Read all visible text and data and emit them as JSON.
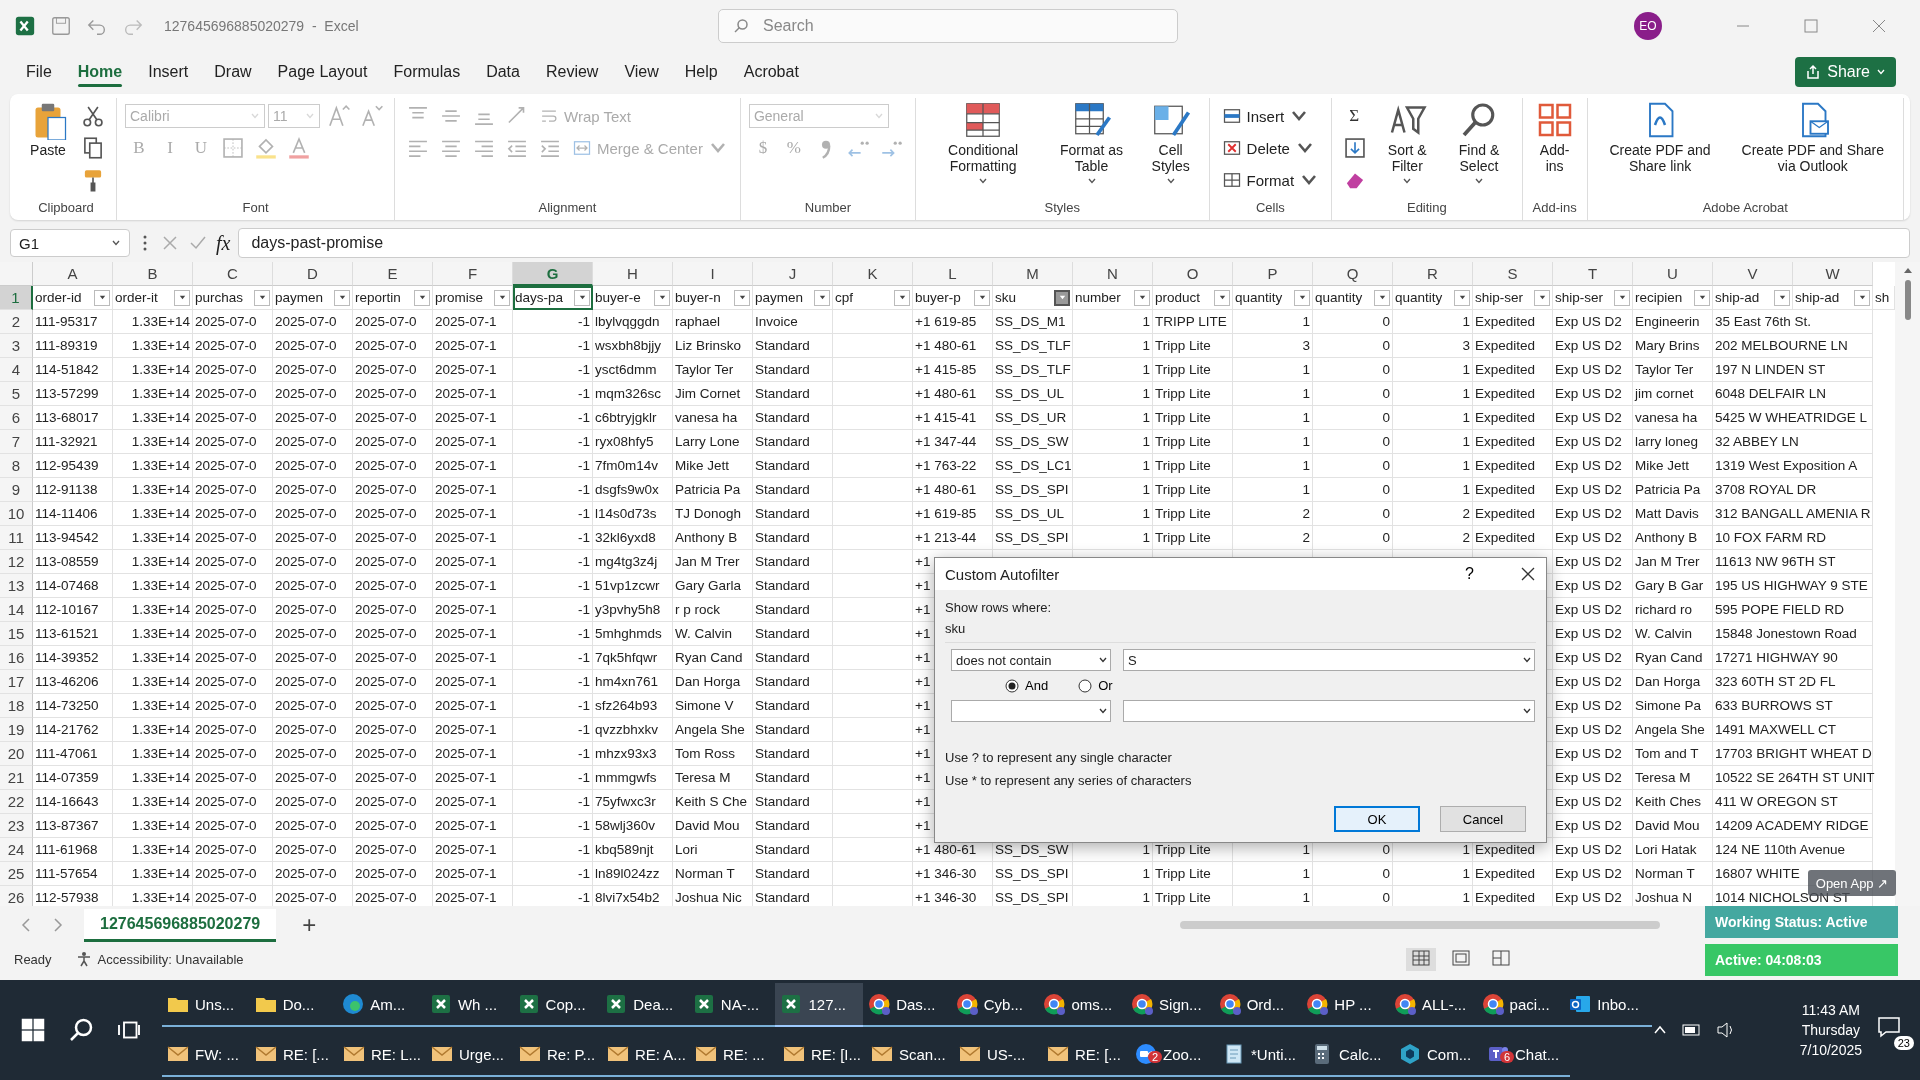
{
  "title_bar": {
    "title": "127645696885020279  -  Excel",
    "search": {
      "placeholder": "Search"
    },
    "avatar": "EO"
  },
  "ribbon_tabs": [
    {
      "label": "File",
      "selected": false
    },
    {
      "label": "Home",
      "selected": true
    },
    {
      "label": "Insert",
      "selected": false
    },
    {
      "label": "Draw",
      "selected": false
    },
    {
      "label": "Page Layout",
      "selected": false
    },
    {
      "label": "Formulas",
      "selected": false
    },
    {
      "label": "Data",
      "selected": false
    },
    {
      "label": "Review",
      "selected": false
    },
    {
      "label": "View",
      "selected": false
    },
    {
      "label": "Help",
      "selected": false
    },
    {
      "label": "Acrobat",
      "selected": false
    }
  ],
  "share_button": "Share",
  "ribbon": [
    {
      "label": "Clipboard",
      "disabled": false,
      "items": [
        {
          "kind": "big",
          "label": "Paste",
          "dropdown": false
        },
        {
          "kind": "stack",
          "rows": [
            [
              {
                "kind": "icon"
              }
            ],
            [
              {
                "kind": "icon"
              }
            ],
            [
              {
                "kind": "icon"
              }
            ]
          ]
        }
      ]
    },
    {
      "label": "Font",
      "disabled": true,
      "items": [
        {
          "kind": "stack",
          "rows": [
            [
              {
                "kind": "combo",
                "value": "Calibri"
              },
              {
                "kind": "combo",
                "value": "11"
              },
              {
                "kind": "icon"
              },
              {
                "kind": "icon"
              }
            ],
            [
              {
                "kind": "glyph",
                "label": "B"
              },
              {
                "kind": "glyph",
                "label": "I"
              },
              {
                "kind": "glyph",
                "label": "U"
              },
              {
                "kind": "icon"
              },
              {
                "kind": "icon"
              },
              {
                "kind": "icon"
              }
            ]
          ]
        }
      ]
    },
    {
      "label": "Alignment",
      "disabled": true,
      "items": [
        {
          "kind": "stack",
          "rows": [
            [
              {
                "kind": "icon"
              },
              {
                "kind": "icon"
              },
              {
                "kind": "icon"
              },
              {
                "kind": "icon"
              },
              {
                "kind": "small",
                "label": "Wrap Text",
                "dropdown": false
              }
            ],
            [
              {
                "kind": "icon"
              },
              {
                "kind": "icon"
              },
              {
                "kind": "icon"
              },
              {
                "kind": "icon"
              },
              {
                "kind": "icon"
              },
              {
                "kind": "small",
                "label": "Merge & Center",
                "dropdown": true
              }
            ]
          ]
        }
      ]
    },
    {
      "label": "Number",
      "disabled": true,
      "items": [
        {
          "kind": "stack",
          "rows": [
            [
              {
                "kind": "combo",
                "value": "General"
              }
            ],
            [
              {
                "kind": "glyph",
                "label": "$"
              },
              {
                "kind": "glyph",
                "label": "%"
              },
              {
                "kind": "icon"
              },
              {
                "kind": "icon"
              },
              {
                "kind": "icon"
              }
            ]
          ]
        }
      ]
    },
    {
      "label": "Styles",
      "disabled": false,
      "items": [
        {
          "kind": "big",
          "label": "Conditional Formatting",
          "dropdown": true
        },
        {
          "kind": "big",
          "label": "Format as Table",
          "dropdown": true
        },
        {
          "kind": "big",
          "label": "Cell Styles",
          "dropdown": true
        }
      ]
    },
    {
      "label": "Cells",
      "disabled": false,
      "items": [
        {
          "kind": "stack",
          "rows": [
            [
              {
                "kind": "small",
                "label": "Insert",
                "dropdown": true
              }
            ],
            [
              {
                "kind": "small",
                "label": "Delete",
                "dropdown": true
              }
            ],
            [
              {
                "kind": "small",
                "label": "Format",
                "dropdown": true
              }
            ]
          ]
        }
      ]
    },
    {
      "label": "Editing",
      "disabled": false,
      "items": [
        {
          "kind": "stack",
          "rows": [
            [
              {
                "kind": "glyph",
                "label": "Σ"
              }
            ],
            [
              {
                "kind": "icon"
              }
            ],
            [
              {
                "kind": "icon"
              }
            ]
          ]
        },
        {
          "kind": "big",
          "label": "Sort & Filter",
          "dropdown": true
        },
        {
          "kind": "big",
          "label": "Find & Select",
          "dropdown": true
        }
      ]
    },
    {
      "label": "Add-ins",
      "disabled": false,
      "items": [
        {
          "kind": "big",
          "label": "Add-ins",
          "dropdown": false
        }
      ]
    },
    {
      "label": "Adobe Acrobat",
      "disabled": false,
      "items": [
        {
          "kind": "big",
          "label": "Create PDF and Share link",
          "dropdown": false
        },
        {
          "kind": "big",
          "label": "Create PDF and Share via Outlook",
          "dropdown": false
        }
      ]
    }
  ],
  "formula_bar": {
    "name_box": "G1",
    "fx": "fx",
    "formula": "days-past-promise"
  },
  "grid": {
    "columns": [
      {
        "letter": "A",
        "selected": false
      },
      {
        "letter": "B",
        "selected": false
      },
      {
        "letter": "C",
        "selected": false
      },
      {
        "letter": "D",
        "selected": false
      },
      {
        "letter": "E",
        "selected": false
      },
      {
        "letter": "F",
        "selected": false
      },
      {
        "letter": "G",
        "selected": true
      },
      {
        "letter": "H",
        "selected": false
      },
      {
        "letter": "I",
        "selected": false
      },
      {
        "letter": "J",
        "selected": false
      },
      {
        "letter": "K",
        "selected": false
      },
      {
        "letter": "L",
        "selected": false
      },
      {
        "letter": "M",
        "selected": false
      },
      {
        "letter": "N",
        "selected": false
      },
      {
        "letter": "O",
        "selected": false
      },
      {
        "letter": "P",
        "selected": false
      },
      {
        "letter": "Q",
        "selected": false
      },
      {
        "letter": "R",
        "selected": false
      },
      {
        "letter": "S",
        "selected": false
      },
      {
        "letter": "T",
        "selected": false
      },
      {
        "letter": "U",
        "selected": false
      },
      {
        "letter": "V",
        "selected": false
      },
      {
        "letter": "W",
        "selected": false
      }
    ],
    "header_row": {
      "number": "1",
      "selected": true,
      "cells": [
        {
          "label": "order-id",
          "selected": false,
          "filter_open": false
        },
        {
          "label": "order-it",
          "selected": false,
          "filter_open": false
        },
        {
          "label": "purchas",
          "selected": false,
          "filter_open": false
        },
        {
          "label": "paymen",
          "selected": false,
          "filter_open": false
        },
        {
          "label": "reportin",
          "selected": false,
          "filter_open": false
        },
        {
          "label": "promise",
          "selected": false,
          "filter_open": false
        },
        {
          "label": "days-pa",
          "selected": true,
          "filter_open": false
        },
        {
          "label": "buyer-e",
          "selected": false,
          "filter_open": false
        },
        {
          "label": "buyer-n",
          "selected": false,
          "filter_open": false
        },
        {
          "label": "paymen",
          "selected": false,
          "filter_open": false
        },
        {
          "label": "cpf",
          "selected": false,
          "filter_open": false
        },
        {
          "label": "buyer-p",
          "selected": false,
          "filter_open": false
        },
        {
          "label": "sku",
          "selected": false,
          "filter_open": true
        },
        {
          "label": "number",
          "selected": false,
          "filter_open": false
        },
        {
          "label": "product",
          "selected": false,
          "filter_open": false
        },
        {
          "label": "quantity",
          "selected": false,
          "filter_open": false
        },
        {
          "label": "quantity",
          "selected": false,
          "filter_open": false
        },
        {
          "label": "quantity",
          "selected": false,
          "filter_open": false
        },
        {
          "label": "ship-ser",
          "selected": false,
          "filter_open": false
        },
        {
          "label": "ship-ser",
          "selected": false,
          "filter_open": false
        },
        {
          "label": "recipien",
          "selected": false,
          "filter_open": false
        },
        {
          "label": "ship-ad",
          "selected": false,
          "filter_open": false
        },
        {
          "label": "ship-ad",
          "selected": false,
          "filter_open": false
        },
        {
          "label": "sh",
          "selected": false
        }
      ]
    },
    "rows": [
      {
        "number": "2",
        "cells": [
          "111-95317",
          "1.33E+14",
          "2025-07-0",
          "2025-07-0",
          "2025-07-0",
          "2025-07-1",
          "-1",
          "lbylvqggdn",
          "raphael",
          "Invoice",
          null,
          "+1 619-85",
          "SS_DS_M1",
          "1",
          "TRIPP LITE",
          "1",
          "0",
          "1",
          "Expedited",
          "Exp US D2",
          "Engineerin",
          "35 East 76th St.",
          null
        ]
      },
      {
        "number": "3",
        "cells": [
          "111-89319",
          "1.33E+14",
          "2025-07-0",
          "2025-07-0",
          "2025-07-0",
          "2025-07-1",
          "-1",
          "wsxbh8bjjy",
          "Liz Brinsko",
          "Standard",
          null,
          "+1 480-61",
          "SS_DS_TLF",
          "1",
          "Tripp Lite",
          "3",
          "0",
          "3",
          "Expedited",
          "Exp US D2",
          "Mary Brins",
          "202 MELBOURNE LN",
          null
        ]
      },
      {
        "number": "4",
        "cells": [
          "114-51842",
          "1.33E+14",
          "2025-07-0",
          "2025-07-0",
          "2025-07-0",
          "2025-07-1",
          "-1",
          "ysct6dmm",
          "Taylor Ter",
          "Standard",
          null,
          "+1 415-85",
          "SS_DS_TLF",
          "1",
          "Tripp Lite",
          "1",
          "0",
          "1",
          "Expedited",
          "Exp US D2",
          "Taylor Ter",
          "197 N LINDEN ST",
          null
        ]
      },
      {
        "number": "5",
        "cells": [
          "113-57299",
          "1.33E+14",
          "2025-07-0",
          "2025-07-0",
          "2025-07-0",
          "2025-07-1",
          "-1",
          "mqm326sc",
          "Jim Cornet",
          "Standard",
          null,
          "+1 480-61",
          "SS_DS_UL",
          "1",
          "Tripp Lite",
          "1",
          "0",
          "1",
          "Expedited",
          "Exp US D2",
          "jim cornet",
          "6048 DELFAIR LN",
          null
        ]
      },
      {
        "number": "6",
        "cells": [
          "113-68017",
          "1.33E+14",
          "2025-07-0",
          "2025-07-0",
          "2025-07-0",
          "2025-07-1",
          "-1",
          "c6btryjgklr",
          "vanesa ha",
          "Standard",
          null,
          "+1 415-41",
          "SS_DS_UR",
          "1",
          "Tripp Lite",
          "1",
          "0",
          "1",
          "Expedited",
          "Exp US D2",
          "vanesa ha",
          "5425 W WHEATRIDGE L",
          null
        ]
      },
      {
        "number": "7",
        "cells": [
          "111-32921",
          "1.33E+14",
          "2025-07-0",
          "2025-07-0",
          "2025-07-0",
          "2025-07-1",
          "-1",
          "ryx08hfy5",
          "Larry Lone",
          "Standard",
          null,
          "+1 347-44",
          "SS_DS_SW",
          "1",
          "Tripp Lite",
          "1",
          "0",
          "1",
          "Expedited",
          "Exp US D2",
          "larry loneg",
          "32 ABBEY LN",
          null
        ]
      },
      {
        "number": "8",
        "cells": [
          "112-95439",
          "1.33E+14",
          "2025-07-0",
          "2025-07-0",
          "2025-07-0",
          "2025-07-1",
          "-1",
          "7fm0m14v",
          "Mike Jett",
          "Standard",
          null,
          "+1 763-22",
          "SS_DS_LC1",
          "1",
          "Tripp Lite",
          "1",
          "0",
          "1",
          "Expedited",
          "Exp US D2",
          "Mike Jett",
          "1319 West Exposition A",
          null
        ]
      },
      {
        "number": "9",
        "cells": [
          "112-91138",
          "1.33E+14",
          "2025-07-0",
          "2025-07-0",
          "2025-07-0",
          "2025-07-1",
          "-1",
          "dsgfs9w0x",
          "Patricia Pa",
          "Standard",
          null,
          "+1 480-61",
          "SS_DS_SPI",
          "1",
          "Tripp Lite",
          "1",
          "0",
          "1",
          "Expedited",
          "Exp US D2",
          "Patricia Pa",
          "3708 ROYAL DR",
          null
        ]
      },
      {
        "number": "10",
        "cells": [
          "114-11406",
          "1.33E+14",
          "2025-07-0",
          "2025-07-0",
          "2025-07-0",
          "2025-07-1",
          "-1",
          "l14s0d73s",
          "TJ Donogh",
          "Standard",
          null,
          "+1 619-85",
          "SS_DS_UL",
          "1",
          "Tripp Lite",
          "2",
          "0",
          "2",
          "Expedited",
          "Exp US D2",
          "Matt Davis",
          "312 BANGALL AMENIA R",
          null
        ]
      },
      {
        "number": "11",
        "cells": [
          "113-94542",
          "1.33E+14",
          "2025-07-0",
          "2025-07-0",
          "2025-07-0",
          "2025-07-1",
          "-1",
          "32kl6yxd8",
          "Anthony B",
          "Standard",
          null,
          "+1 213-44",
          "SS_DS_SPI",
          "1",
          "Tripp Lite",
          "2",
          "0",
          "2",
          "Expedited",
          "Exp US D2",
          "Anthony B",
          "10 FOX FARM RD",
          null
        ]
      },
      {
        "number": "12",
        "cells": [
          "113-08559",
          "1.33E+14",
          "2025-07-0",
          "2025-07-0",
          "2025-07-0",
          "2025-07-1",
          "-1",
          "mg4tg3z4j",
          "Jan M Trer",
          "Standard",
          null,
          "+1",
          null,
          null,
          null,
          null,
          null,
          null,
          null,
          "Exp US D2",
          "Jan M Trer",
          "11613 NW 96TH ST",
          null
        ]
      },
      {
        "number": "13",
        "cells": [
          "114-07468",
          "1.33E+14",
          "2025-07-0",
          "2025-07-0",
          "2025-07-0",
          "2025-07-1",
          "-1",
          "51vp1zcwr",
          "Gary Garla",
          "Standard",
          null,
          "+1",
          null,
          null,
          null,
          null,
          null,
          null,
          null,
          "Exp US D2",
          "Gary B Gar",
          "195 US HIGHWAY 9 STE",
          null
        ]
      },
      {
        "number": "14",
        "cells": [
          "112-10167",
          "1.33E+14",
          "2025-07-0",
          "2025-07-0",
          "2025-07-0",
          "2025-07-1",
          "-1",
          "y3pvhy5h8",
          "r p rock",
          "Standard",
          null,
          "+1",
          null,
          null,
          null,
          null,
          null,
          null,
          null,
          "Exp US D2",
          "richard  ro",
          "595 POPE FIELD RD",
          null
        ]
      },
      {
        "number": "15",
        "cells": [
          "113-61521",
          "1.33E+14",
          "2025-07-0",
          "2025-07-0",
          "2025-07-0",
          "2025-07-1",
          "-1",
          "5mhghmds",
          "W. Calvin",
          "Standard",
          null,
          "+1",
          null,
          null,
          null,
          null,
          null,
          null,
          null,
          "Exp US D2",
          "W. Calvin",
          "15848 Jonestown Road",
          null
        ]
      },
      {
        "number": "16",
        "cells": [
          "114-39352",
          "1.33E+14",
          "2025-07-0",
          "2025-07-0",
          "2025-07-0",
          "2025-07-1",
          "-1",
          "7qk5hfqwr",
          "Ryan Cand",
          "Standard",
          null,
          "+1",
          null,
          null,
          null,
          null,
          null,
          null,
          null,
          "Exp US D2",
          "Ryan Cand",
          "17271 HIGHWAY 90",
          null
        ]
      },
      {
        "number": "17",
        "cells": [
          "113-46206",
          "1.33E+14",
          "2025-07-0",
          "2025-07-0",
          "2025-07-0",
          "2025-07-1",
          "-1",
          "hm4xn761",
          "Dan Horga",
          "Standard",
          null,
          "+1",
          null,
          null,
          null,
          null,
          null,
          null,
          null,
          "Exp US D2",
          "Dan Horga",
          "323 60TH ST 2D FL",
          null
        ]
      },
      {
        "number": "18",
        "cells": [
          "114-73250",
          "1.33E+14",
          "2025-07-0",
          "2025-07-0",
          "2025-07-0",
          "2025-07-1",
          "-1",
          "sfz264b93",
          "Simone V",
          "Standard",
          null,
          "+1",
          null,
          null,
          null,
          null,
          null,
          null,
          null,
          "Exp US D2",
          "Simone Pa",
          "633 BURROWS ST",
          null
        ]
      },
      {
        "number": "19",
        "cells": [
          "114-21762",
          "1.33E+14",
          "2025-07-0",
          "2025-07-0",
          "2025-07-0",
          "2025-07-1",
          "-1",
          "qvzzbhxkv",
          "Angela She",
          "Standard",
          null,
          "+1",
          null,
          null,
          null,
          null,
          null,
          null,
          null,
          "Exp US D2",
          "Angela She",
          "1491 MAXWELL CT",
          null
        ]
      },
      {
        "number": "20",
        "cells": [
          "111-47061",
          "1.33E+14",
          "2025-07-0",
          "2025-07-0",
          "2025-07-0",
          "2025-07-1",
          "-1",
          "mhzx93x3",
          "Tom Ross",
          "Standard",
          null,
          "+1",
          null,
          null,
          null,
          null,
          null,
          null,
          null,
          "Exp US D2",
          "Tom and T",
          "17703 BRIGHT WHEAT D",
          null
        ]
      },
      {
        "number": "21",
        "cells": [
          "114-07359",
          "1.33E+14",
          "2025-07-0",
          "2025-07-0",
          "2025-07-0",
          "2025-07-1",
          "-1",
          "mmmgwfs",
          "Teresa M",
          "Standard",
          null,
          "+1",
          null,
          null,
          null,
          null,
          null,
          null,
          null,
          "Exp US D2",
          "Teresa M",
          "10522 SE 264TH ST UNIT",
          null
        ]
      },
      {
        "number": "22",
        "cells": [
          "114-16643",
          "1.33E+14",
          "2025-07-0",
          "2025-07-0",
          "2025-07-0",
          "2025-07-1",
          "-1",
          "75yfwxc3r",
          "Keith S Che",
          "Standard",
          null,
          "+1",
          null,
          null,
          null,
          null,
          null,
          null,
          null,
          "Exp US D2",
          "Keith Ches",
          "411 W OREGON ST",
          null
        ]
      },
      {
        "number": "23",
        "cells": [
          "113-87367",
          "1.33E+14",
          "2025-07-0",
          "2025-07-0",
          "2025-07-0",
          "2025-07-1",
          "-1",
          "58wlj360v",
          "David Mou",
          "Standard",
          null,
          "+1",
          null,
          null,
          null,
          null,
          null,
          null,
          null,
          "Exp US D2",
          "David Mou",
          "14209 ACADEMY RIDGE",
          null
        ]
      },
      {
        "number": "24",
        "cells": [
          "111-61968",
          "1.33E+14",
          "2025-07-0",
          "2025-07-0",
          "2025-07-0",
          "2025-07-1",
          "-1",
          "kbq589njt",
          "Lori",
          "Standard",
          null,
          "+1 480-61",
          "SS_DS_SW",
          "1",
          "Tripp Lite",
          "1",
          "0",
          "1",
          "Expedited",
          "Exp US D2",
          "Lori Hatak",
          "124 NE 110th Avenue",
          null
        ]
      },
      {
        "number": "25",
        "cells": [
          "111-57654",
          "1.33E+14",
          "2025-07-0",
          "2025-07-0",
          "2025-07-0",
          "2025-07-1",
          "-1",
          "ln89l024zz",
          "Norman T",
          "Standard",
          null,
          "+1 346-30",
          "SS_DS_SPI",
          "1",
          "Tripp Lite",
          "1",
          "0",
          "1",
          "Expedited",
          "Exp US D2",
          "Norman T",
          "16807 WHITE",
          null
        ]
      },
      {
        "number": "26",
        "cells": [
          "112-57938",
          "1.33E+14",
          "2025-07-0",
          "2025-07-0",
          "2025-07-0",
          "2025-07-1",
          "-1",
          "8lvi7x54b2",
          "Joshua Nic",
          "Standard",
          null,
          "+1 346-30",
          "SS_DS_SPI",
          "1",
          "Tripp Lite",
          "1",
          "0",
          "1",
          "Expedited",
          "Exp US D2",
          "Joshua N",
          "1014 NICHOLSON ST",
          null
        ]
      }
    ]
  },
  "dialog": {
    "title": "Custom Autofilter",
    "help": "?",
    "prompt": "Show rows where:",
    "field": "sku",
    "operator": "does not contain",
    "value": "S",
    "logic": [
      {
        "label": "And",
        "selected": true
      },
      {
        "label": "Or",
        "selected": false
      }
    ],
    "hints": [
      "Use ? to represent any single character",
      "Use * to represent any series of characters"
    ],
    "ok": "OK",
    "cancel": "Cancel"
  },
  "sheet_tabs": {
    "tabs": [
      {
        "label": "127645696885020279",
        "selected": true
      }
    ],
    "add": "+"
  },
  "status_bar": {
    "ready": "Ready",
    "accessibility": "Accessibility: Unavailable",
    "views": [
      {
        "kind": "normal",
        "selected": true
      },
      {
        "kind": "layout",
        "selected": false
      },
      {
        "kind": "break",
        "selected": false
      }
    ]
  },
  "overlay": {
    "open_app": "Open App ↗",
    "working_status": "Working Status: Active",
    "active_timer": "Active: 04:08:03"
  },
  "taskbar": {
    "rows": [
      [
        {
          "label": "Uns...",
          "kind": "folder",
          "active": false
        },
        {
          "label": "Do...",
          "kind": "folder",
          "active": false
        },
        {
          "label": "Am...",
          "kind": "edge",
          "active": false
        },
        {
          "label": "Wh ...",
          "kind": "excel",
          "active": false
        },
        {
          "label": "Cop...",
          "kind": "excel",
          "active": false
        },
        {
          "label": "Dea...",
          "kind": "excel",
          "active": false
        },
        {
          "label": "NA-...",
          "kind": "excel",
          "active": false
        },
        {
          "label": "127...",
          "kind": "excel",
          "active": true
        },
        {
          "label": "Das...",
          "kind": "chrome",
          "active": false
        },
        {
          "label": "Cyb...",
          "kind": "chrome",
          "active": false
        },
        {
          "label": "oms...",
          "kind": "chrome",
          "active": false
        },
        {
          "label": "Sign...",
          "kind": "chrome",
          "active": false
        },
        {
          "label": "Ord...",
          "kind": "chrome",
          "active": false
        },
        {
          "label": "HP ...",
          "kind": "chrome",
          "active": false
        },
        {
          "label": "ALL-...",
          "kind": "chrome",
          "active": false
        },
        {
          "label": "paci...",
          "kind": "chrome",
          "active": false
        },
        {
          "label": "Inbo...",
          "kind": "outlook",
          "active": false
        }
      ],
      [
        {
          "label": "FW: ...",
          "kind": "mail",
          "active": false
        },
        {
          "label": "RE: [...",
          "kind": "mail",
          "active": false
        },
        {
          "label": "RE: L...",
          "kind": "mail",
          "active": false
        },
        {
          "label": "Urge...",
          "kind": "mail",
          "active": false
        },
        {
          "label": "Re: P...",
          "kind": "mail",
          "active": false
        },
        {
          "label": "RE: A...",
          "kind": "mail",
          "active": false
        },
        {
          "label": "RE: ...",
          "kind": "mail",
          "active": false
        },
        {
          "label": "RE: [I...",
          "kind": "mail",
          "active": false
        },
        {
          "label": "Scan...",
          "kind": "mail",
          "active": false
        },
        {
          "label": "US-...",
          "kind": "mail",
          "active": false
        },
        {
          "label": "RE: [...",
          "kind": "mail",
          "active": false
        },
        {
          "label": "Zoo...",
          "kind": "zoom",
          "active": false,
          "badge": "2"
        },
        {
          "label": "*Unti...",
          "kind": "notepad",
          "active": false
        },
        {
          "label": "Calc...",
          "kind": "calc",
          "active": false
        },
        {
          "label": "Com...",
          "kind": "copilot",
          "active": false
        },
        {
          "label": "Chat...",
          "kind": "teams",
          "active": false,
          "badge": "6"
        }
      ]
    ],
    "clock": {
      "time": "11:43 AM",
      "day": "Thursday",
      "date": "7/10/2025"
    },
    "notifications": "23"
  }
}
